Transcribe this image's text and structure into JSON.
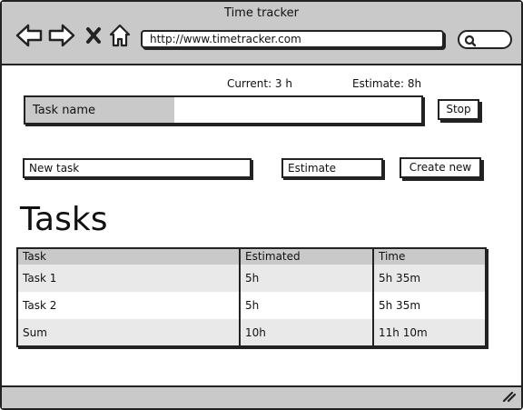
{
  "window": {
    "title": "Time tracker"
  },
  "nav": {
    "back_icon": "back-arrow-icon",
    "forward_icon": "forward-arrow-icon",
    "stop_icon": "close-x-icon",
    "home_icon": "home-icon"
  },
  "address_bar": {
    "url": "http://www.timetracker.com"
  },
  "search": {
    "icon": "search-icon",
    "value": ""
  },
  "tracker": {
    "current_label": "Current: 3 h",
    "estimate_label": "Estimate: 8h",
    "progress_fraction": 0.375,
    "task_name": "Task name",
    "stop_button": "Stop"
  },
  "new_task": {
    "name_placeholder": "New task",
    "estimate_placeholder": "Estimate",
    "create_button": "Create new"
  },
  "tasks": {
    "heading": "Tasks",
    "columns": [
      "Task",
      "Estimated",
      "Time"
    ],
    "rows": [
      [
        "Task 1",
        "5h",
        "5h 35m"
      ],
      [
        "Task 2",
        "5h",
        "5h 35m"
      ],
      [
        "Sum",
        "10h",
        "11h 10m"
      ]
    ]
  },
  "status_bar": {
    "grip_icon": "resize-grip-icon"
  },
  "colors": {
    "chrome": "#c9c9c9",
    "border": "#222222",
    "row_alt": "#e9e9e9"
  }
}
